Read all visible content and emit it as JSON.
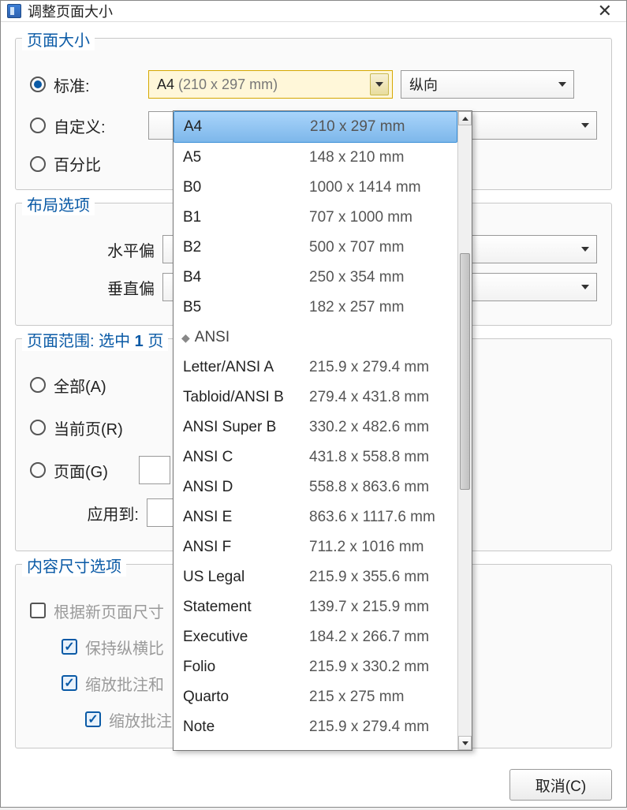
{
  "titlebar": {
    "title": "调整页面大小"
  },
  "pageSize": {
    "title": "页面大小",
    "standard_label": "标准:",
    "custom_label": "自定义:",
    "percent_label": "百分比",
    "standard_value_name": "A4",
    "standard_value_dims": " (210 x 297 mm)",
    "orientation": "纵向"
  },
  "layout": {
    "title": "布局选项",
    "h_offset_label": "水平偏",
    "v_offset_label": "垂直偏"
  },
  "pageRange": {
    "title_prefix": "页面范围: 选中 ",
    "title_bold": "1",
    "title_suffix": " 页",
    "all_label": "全部(A)",
    "current_label": "当前页(R)",
    "pages_label": "页面(G)",
    "apply_to_label": "应用到:"
  },
  "contentSize": {
    "title": "内容尺寸选项",
    "resize_to_page_label": "根据新页面尺寸",
    "keep_aspect_label": "保持纵横比",
    "scale_annot_label": "缩放批注和",
    "scale_annot2_label": "缩放批注"
  },
  "dropdown": {
    "groups": [
      {
        "items": [
          {
            "name": "A4",
            "size": "210 x 297 mm"
          },
          {
            "name": "A5",
            "size": "148 x 210 mm"
          },
          {
            "name": "B0",
            "size": "1000 x 1414 mm"
          },
          {
            "name": "B1",
            "size": "707 x 1000 mm"
          },
          {
            "name": "B2",
            "size": "500 x 707 mm"
          },
          {
            "name": "B4",
            "size": "250 x 354 mm"
          },
          {
            "name": "B5",
            "size": "182 x 257 mm"
          }
        ]
      },
      {
        "header": "ANSI",
        "items": [
          {
            "name": "Letter/ANSI A",
            "size": "215.9 x 279.4 mm"
          },
          {
            "name": "Tabloid/ANSI B",
            "size": "279.4 x 431.8 mm"
          },
          {
            "name": "ANSI Super B",
            "size": "330.2 x 482.6 mm"
          },
          {
            "name": "ANSI C",
            "size": "431.8 x 558.8 mm"
          },
          {
            "name": "ANSI D",
            "size": "558.8 x 863.6 mm"
          },
          {
            "name": "ANSI E",
            "size": "863.6 x 1117.6 mm"
          },
          {
            "name": "ANSI F",
            "size": "711.2 x 1016 mm"
          },
          {
            "name": "US Legal",
            "size": "215.9 x 355.6 mm"
          },
          {
            "name": "Statement",
            "size": "139.7 x 215.9 mm"
          },
          {
            "name": "Executive",
            "size": "184.2 x 266.7 mm"
          },
          {
            "name": "Folio",
            "size": "215.9 x 330.2 mm"
          },
          {
            "name": "Quarto",
            "size": "215 x 275 mm"
          },
          {
            "name": "Note",
            "size": "215.9 x 279.4 mm"
          }
        ]
      }
    ]
  },
  "footer": {
    "cancel": "取消(C)"
  }
}
